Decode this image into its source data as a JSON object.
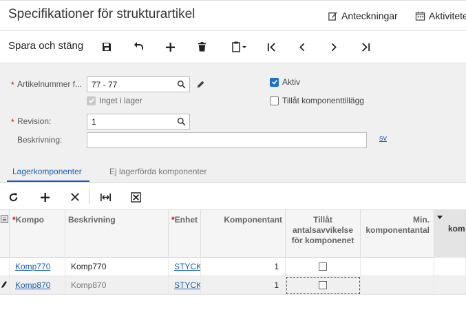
{
  "header": {
    "title": "Specifikationer för strukturartikel",
    "notes_label": "Anteckningar",
    "activities_label": "Aktiviteter"
  },
  "toolbar": {
    "save_close_label": "Spara och stäng"
  },
  "form": {
    "item_number_label": "Artikelnummer f...",
    "item_number_value": "77 - 77",
    "not_in_stock_label": "Inget i lager",
    "not_in_stock_checked": true,
    "active_label": "Aktiv",
    "active_checked": true,
    "allow_component_label": "Tillåt komponenttillägg",
    "allow_component_checked": false,
    "revision_label": "Revision:",
    "revision_value": "1",
    "description_label": "Beskrivning:",
    "description_value": "",
    "language_link": "sv"
  },
  "tabs": [
    {
      "label": "Lagerkomponenter",
      "active": true
    },
    {
      "label": "Ej lagerförda komponenter",
      "active": false
    }
  ],
  "grid": {
    "columns": [
      {
        "label": "Kompo",
        "required": true
      },
      {
        "label": "Beskrivning",
        "required": false
      },
      {
        "label": "Enhet",
        "required": true
      },
      {
        "label": "Komponentant",
        "required": false
      },
      {
        "label": "Tillåt antalsavvikelse för komponenet",
        "required": false
      },
      {
        "label": "Min. komponentantal",
        "required": false
      },
      {
        "label": "kom",
        "required": false
      }
    ],
    "rows": [
      {
        "component": "Komp770",
        "description": "Komp770",
        "unit": "STYCK",
        "quantity": "1",
        "allow_deviation": false
      },
      {
        "component": "Komp870",
        "description": "Komp870",
        "unit": "STYCK",
        "quantity": "1",
        "allow_deviation": false
      }
    ]
  },
  "colors": {
    "accent": "#1a5fb4",
    "checkbox_blue": "#1a73c9",
    "required": "#cc0000"
  }
}
